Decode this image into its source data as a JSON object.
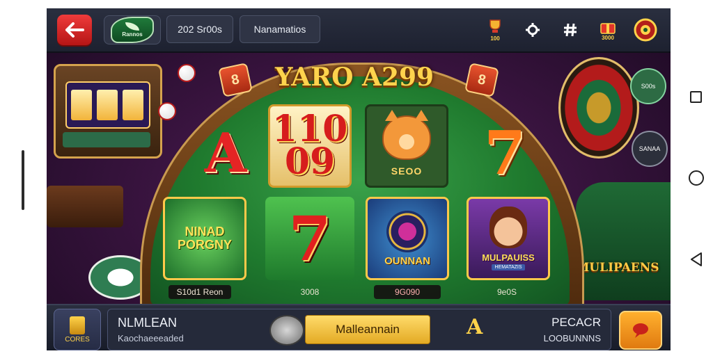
{
  "top_bar": {
    "logo_text": "Rannos",
    "pill_balance": "202 Sr00s",
    "pill_name": "Nanamatios",
    "icons": [
      "trophy-icon",
      "gear-icon",
      "hash-icon",
      "gift-icon",
      "roulette-icon"
    ],
    "gift_caption": "3000",
    "trophy_caption": "100"
  },
  "table": {
    "title": "YARO A299",
    "badge_left": "8",
    "badge_right": "8"
  },
  "tiles": [
    {
      "glyph": "A"
    },
    {
      "glyph_line1": "110",
      "glyph_line2": "09"
    },
    {
      "label": "SEOO"
    },
    {
      "glyph": "7"
    },
    {
      "line1": "NINAD",
      "line2": "PORGNY"
    },
    {
      "glyph": "7"
    },
    {
      "label": "OUNNAN"
    },
    {
      "label": "MULPAUISS",
      "sub": "HEMATAZIS"
    }
  ],
  "prices": {
    "p1": "S10d1 Reon",
    "p2": "3008",
    "p3": "9G090",
    "p4": "9e0S"
  },
  "side": {
    "btn_a": "S00s",
    "btn_b": "SANAA",
    "logo": "MULIPAENS"
  },
  "bottom_bar": {
    "left_label": "CORES",
    "title": "NLMLEAN",
    "subtitle": "Kaochaeeeaded",
    "main_button": "Malleannain",
    "emblem": "A",
    "right_title": "PECACR",
    "right_sub": "LOOBUNNNS"
  },
  "colors": {
    "accent_gold": "#ffd34a",
    "felt_green": "#1f7a2e",
    "back_red": "#e52a2a"
  }
}
